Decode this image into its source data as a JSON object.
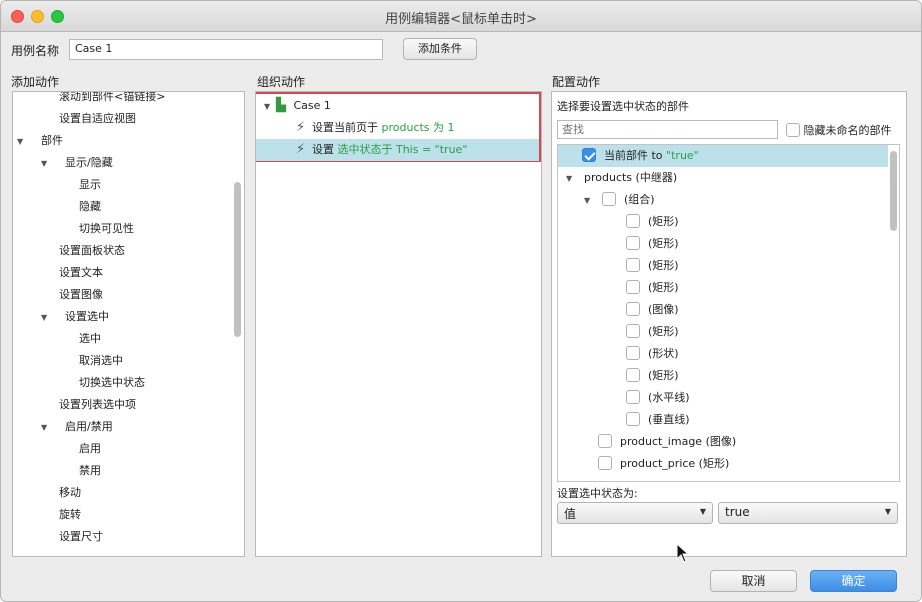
{
  "window": {
    "title": "用例编辑器<鼠标单击时>"
  },
  "case_name": {
    "label": "用例名称",
    "value": "Case 1",
    "add_condition": "添加条件"
  },
  "add_action": {
    "header": "添加动作",
    "items": [
      {
        "label": "滚动到部件<锚链接>",
        "level": 2,
        "arrow": ""
      },
      {
        "label": "设置自适应视图",
        "level": 2,
        "arrow": ""
      },
      {
        "label": "部件",
        "level": 0,
        "arrow": "▼"
      },
      {
        "label": "显示/隐藏",
        "level": 1,
        "arrow": "▼"
      },
      {
        "label": "显示",
        "level": 3,
        "arrow": ""
      },
      {
        "label": "隐藏",
        "level": 3,
        "arrow": ""
      },
      {
        "label": "切换可见性",
        "level": 3,
        "arrow": ""
      },
      {
        "label": "设置面板状态",
        "level": 2,
        "arrow": ""
      },
      {
        "label": "设置文本",
        "level": 2,
        "arrow": ""
      },
      {
        "label": "设置图像",
        "level": 2,
        "arrow": ""
      },
      {
        "label": "设置选中",
        "level": 1,
        "arrow": "▼"
      },
      {
        "label": "选中",
        "level": 3,
        "arrow": ""
      },
      {
        "label": "取消选中",
        "level": 3,
        "arrow": ""
      },
      {
        "label": "切换选中状态",
        "level": 3,
        "arrow": ""
      },
      {
        "label": "设置列表选中项",
        "level": 2,
        "arrow": ""
      },
      {
        "label": "启用/禁用",
        "level": 1,
        "arrow": "▼"
      },
      {
        "label": "启用",
        "level": 3,
        "arrow": ""
      },
      {
        "label": "禁用",
        "level": 3,
        "arrow": ""
      },
      {
        "label": "移动",
        "level": 2,
        "arrow": ""
      },
      {
        "label": "旋转",
        "level": 2,
        "arrow": ""
      },
      {
        "label": "设置尺寸",
        "level": 2,
        "arrow": ""
      }
    ]
  },
  "organize": {
    "header": "组织动作",
    "case_label": "Case 1",
    "actions": [
      {
        "prefix": "设置当前页于 ",
        "highlight": "products 为 1",
        "suffix": ""
      },
      {
        "prefix": "设置 ",
        "highlight": "选中状态于 This = \"true\"",
        "suffix": ""
      }
    ]
  },
  "configure": {
    "header": "配置动作",
    "sub_header": "选择要设置选中状态的部件",
    "search_placeholder": "查找",
    "hide_unnamed": "隐藏未命名的部件",
    "tree": [
      {
        "label": "当前部件 to ",
        "value": "\"true\"",
        "checked": true,
        "selected": true,
        "kind": "check",
        "level": 0
      },
      {
        "label": "products (中继器)",
        "kind": "arrow",
        "level": 0
      },
      {
        "label": "(组合)",
        "kind": "arrowcheck",
        "level": 1
      },
      {
        "label": "(矩形)",
        "kind": "check",
        "level": 2
      },
      {
        "label": "(矩形)",
        "kind": "check",
        "level": 2
      },
      {
        "label": "(矩形)",
        "kind": "check",
        "level": 2
      },
      {
        "label": "(矩形)",
        "kind": "check",
        "level": 2
      },
      {
        "label": "(图像)",
        "kind": "check",
        "level": 2
      },
      {
        "label": "(矩形)",
        "kind": "check",
        "level": 2
      },
      {
        "label": "(形状)",
        "kind": "check",
        "level": 2
      },
      {
        "label": "(矩形)",
        "kind": "check",
        "level": 2
      },
      {
        "label": "(水平线)",
        "kind": "check",
        "level": 2
      },
      {
        "label": "(垂直线)",
        "kind": "check",
        "level": 2
      },
      {
        "label": "product_image (图像)",
        "kind": "check",
        "level": 1
      },
      {
        "label": "product_price (矩形)",
        "kind": "check",
        "level": 1
      }
    ],
    "set_state_label": "设置选中状态为:",
    "type_select": "值",
    "value_select": "true"
  },
  "footer": {
    "cancel": "取消",
    "ok": "确定"
  }
}
